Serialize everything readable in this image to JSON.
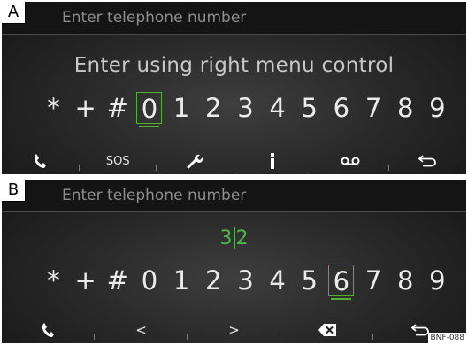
{
  "panel_a": {
    "letter": "A",
    "header": "Enter telephone number",
    "hint": "Enter using right menu control",
    "keys": [
      "*",
      "+",
      "#",
      "0",
      "1",
      "2",
      "3",
      "4",
      "5",
      "6",
      "7",
      "8",
      "9"
    ],
    "selected_key": "0",
    "softkeys": [
      "phone-icon",
      "SOS",
      "wrench-icon",
      "info-icon",
      "voicemail-icon",
      "back-icon"
    ],
    "sos_label": "SOS"
  },
  "panel_b": {
    "letter": "B",
    "header": "Enter telephone number",
    "entered_before_cursor": "3",
    "entered_after_cursor": "2",
    "keys": [
      "*",
      "+",
      "#",
      "0",
      "1",
      "2",
      "3",
      "4",
      "5",
      "6",
      "7",
      "8",
      "9"
    ],
    "selected_key": "6",
    "softkeys": [
      "phone-icon",
      "left-arrow-icon",
      "right-arrow-icon",
      "backspace-icon",
      "back-icon"
    ],
    "left_label": "<",
    "right_label": ">",
    "figure_code": "BNF-088"
  },
  "colors": {
    "accent": "#55b030",
    "entry_text": "#4cb84c",
    "background": "#2a2a2a"
  }
}
